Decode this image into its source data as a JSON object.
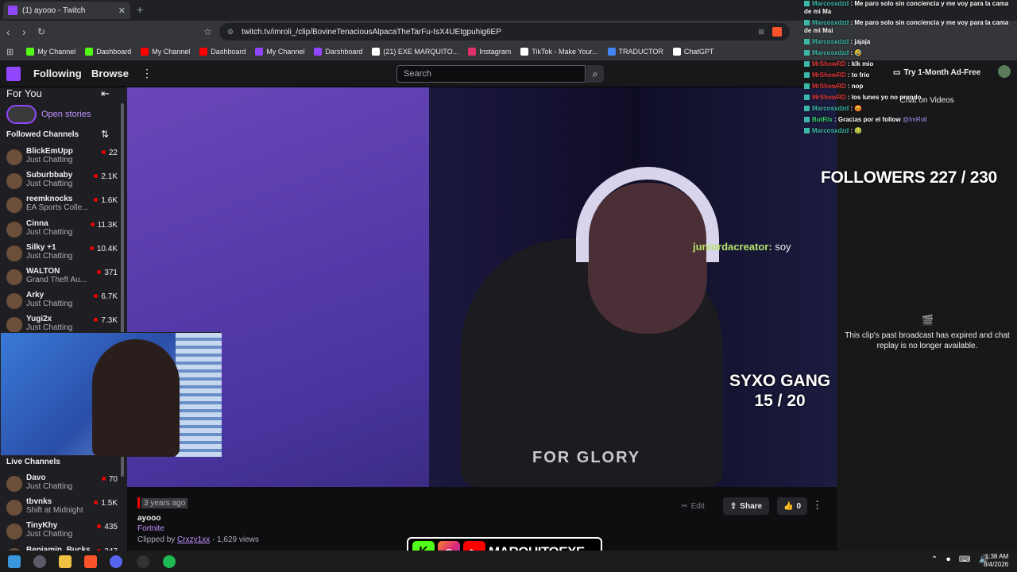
{
  "browser": {
    "tab_title": "(1) ayooo - Twitch",
    "new_tab": "+",
    "url": "twitch.tv/imroli_/clip/BovineTenaciousAlpacaTheTarFu-tsX4UEtgpuhig6EP",
    "bookmarks": [
      {
        "label": "My Channel",
        "color": "#53fc18"
      },
      {
        "label": "Dashboard",
        "color": "#53fc18"
      },
      {
        "label": "My Channel",
        "color": "#ff0000"
      },
      {
        "label": "Dashboard",
        "color": "#ff0000"
      },
      {
        "label": "My Channel",
        "color": "#9146ff"
      },
      {
        "label": "Darshboard",
        "color": "#9146ff"
      },
      {
        "label": "(21) EXE MARQUITO...",
        "color": "#ffffff"
      },
      {
        "label": "Instagram",
        "color": "#e1306c"
      },
      {
        "label": "TikTok - Make Your...",
        "color": "#ffffff"
      },
      {
        "label": "TRADUCTOR",
        "color": "#4285f4"
      },
      {
        "label": "ChatGPT",
        "color": "#ffffff"
      }
    ]
  },
  "topnav": {
    "following": "Following",
    "browse": "Browse",
    "search_placeholder": "Search",
    "ad_free": "Try 1-Month Ad-Free"
  },
  "sidebar": {
    "for_you": "For You",
    "open_stories": "Open stories",
    "followed_title": "Followed Channels",
    "channels": [
      {
        "name": "BlickEmUpp",
        "game": "Just Chatting",
        "viewers": "22"
      },
      {
        "name": "Suburbbaby",
        "game": "Just Chatting",
        "viewers": "2.1K"
      },
      {
        "name": "reemknocks",
        "game": "EA Sports Colle...",
        "viewers": "1.6K"
      },
      {
        "name": "Cinna",
        "game": "Just Chatting",
        "viewers": "11.3K"
      },
      {
        "name": "Silky +1",
        "game": "Just Chatting",
        "viewers": "10.4K"
      },
      {
        "name": "WALTON",
        "game": "Grand Theft Au...",
        "viewers": "371"
      },
      {
        "name": "Arky",
        "game": "Just Chatting",
        "viewers": "6.7K"
      },
      {
        "name": "Yugi2x",
        "game": "Just Chatting",
        "viewers": "7.3K"
      }
    ],
    "live_title": "Live Channels",
    "live_channels": [
      {
        "name": "Davo",
        "game": "Just Chatting",
        "viewers": "70"
      },
      {
        "name": "tbvnks",
        "game": "Shift at Midnight",
        "viewers": "1.5K"
      },
      {
        "name": "TinyKhy",
        "game": "Just Chatting",
        "viewers": "435"
      },
      {
        "name": "Benjamin_Bucks",
        "game": "",
        "viewers": "347"
      }
    ]
  },
  "video": {
    "chat_user": "juniordacreator:",
    "chat_text": "soy",
    "gang_title": "SYXO GANG",
    "gang_count": "15 / 20",
    "shirt_text": "FOR GLORY"
  },
  "clip": {
    "ago": "3 years ago",
    "title": "ayooo",
    "category": "Fortnite",
    "clipped_by_label": "Clipped by",
    "clipper": "Crxzy1xx",
    "views": "1,629 views",
    "edit": "Edit",
    "share": "Share",
    "likes": "0"
  },
  "brand": {
    "name": "MARQUITOEXE"
  },
  "right": {
    "chat_on_videos": "Chat on Videos",
    "expired": "This clip's past broadcast has expired and chat replay is no longer available."
  },
  "overlay_chat": [
    {
      "user": "Marcosxdzd",
      "msg": "Me paro solo sin conciencia y me voy para la cama de mi Ma",
      "cls": ""
    },
    {
      "user": "Marcosxdzd",
      "msg": "Me paro solo sin conciencia y me voy para la cama de mi Mai",
      "cls": ""
    },
    {
      "user": "Marcosxdzd",
      "msg": "jajaja",
      "cls": ""
    },
    {
      "user": "Marcosxdzd",
      "msg": "🤣",
      "cls": ""
    },
    {
      "user": "MrShowRD",
      "msg": "klk mio",
      "cls": "r"
    },
    {
      "user": "MrShowRD",
      "msg": "to frio",
      "cls": "r"
    },
    {
      "user": "MrShowRD",
      "msg": "nop",
      "cls": "r"
    },
    {
      "user": "MrShowRD",
      "msg": "los lunes yo no prendo",
      "cls": "r"
    },
    {
      "user": "Marcosxdzd",
      "msg": "😡",
      "cls": ""
    },
    {
      "user": "BotRix",
      "msg": "Gracias por el follow ",
      "mention": "@ImRoli",
      "cls": "g"
    },
    {
      "user": "Marcosxdzd",
      "msg": "🤢",
      "cls": ""
    }
  ],
  "followers_goal": "FOLLOWERS 227 / 230",
  "taskbar": {
    "time": "1:38 AM",
    "date": "8/4/2026"
  },
  "colors": {
    "twitch_purple": "#9146ff",
    "live_red": "#eb0400",
    "link_purple": "#bf94ff"
  }
}
